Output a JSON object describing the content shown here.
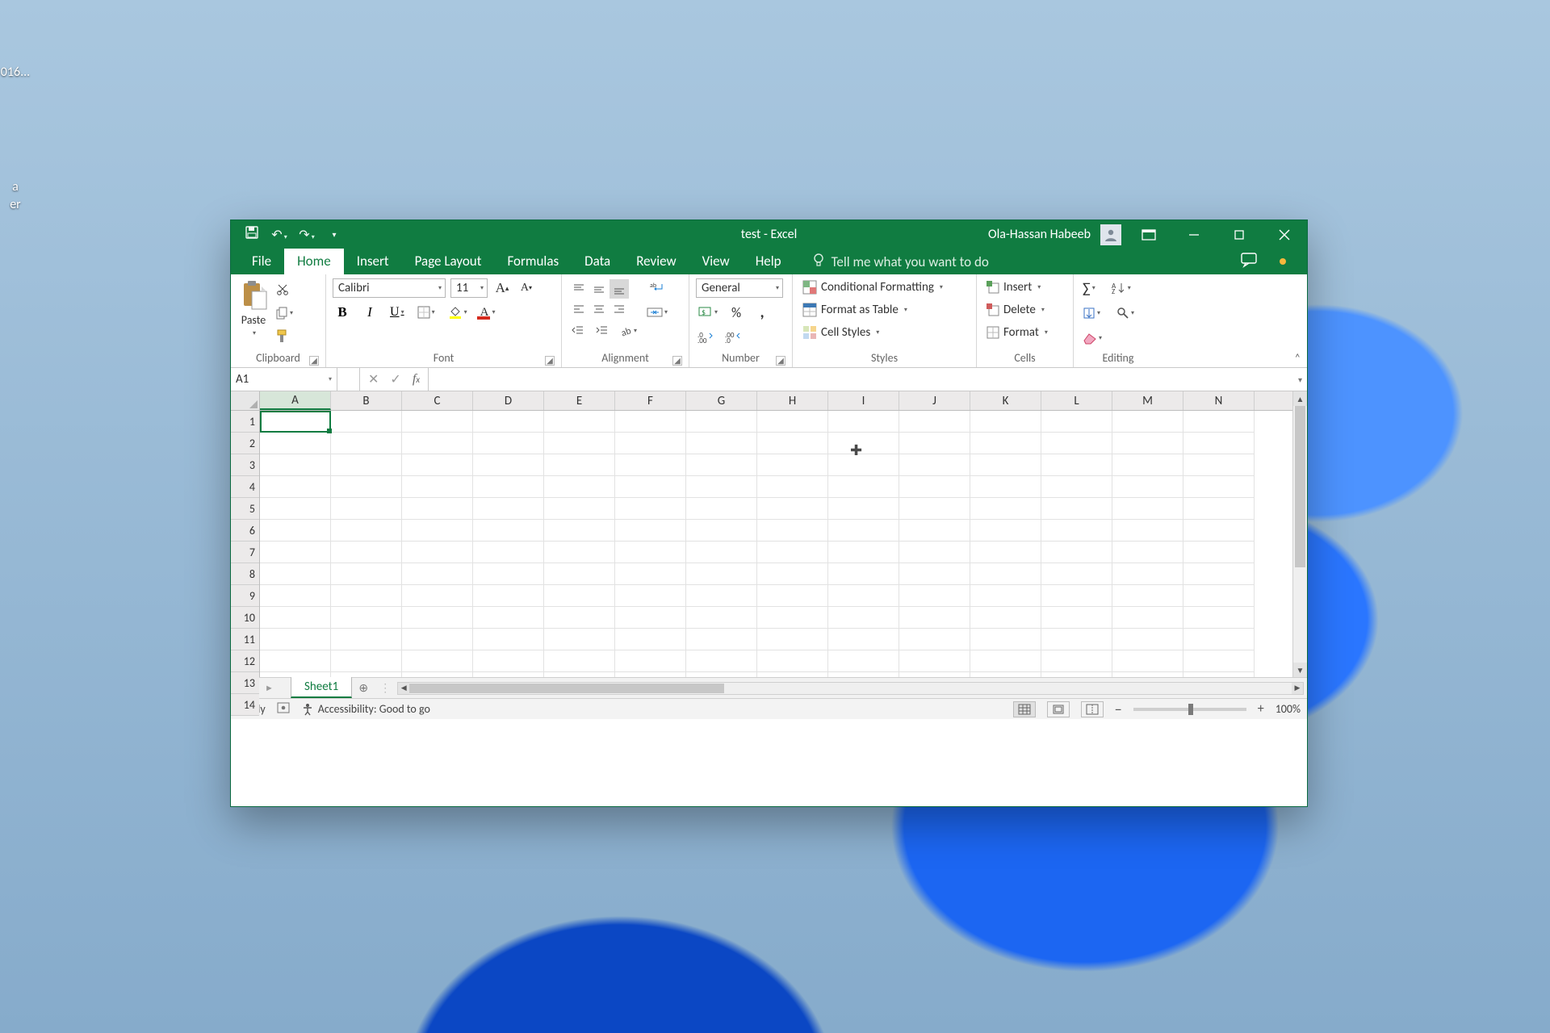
{
  "desktop": {
    "icon1_label": "016...",
    "icon2_label": "a",
    "icon3_label": "er"
  },
  "titlebar": {
    "doc_title": "test  -  Excel",
    "user_name": "Ola-Hassan Habeeb"
  },
  "tabs": {
    "file": "File",
    "home": "Home",
    "insert": "Insert",
    "page_layout": "Page Layout",
    "formulas": "Formulas",
    "data": "Data",
    "review": "Review",
    "view": "View",
    "help": "Help",
    "tell_me": "Tell me what you want to do"
  },
  "ribbon": {
    "clipboard": {
      "paste": "Paste",
      "label": "Clipboard"
    },
    "font": {
      "name": "Calibri",
      "size": "11",
      "label": "Font"
    },
    "alignment": {
      "label": "Alignment"
    },
    "number": {
      "format": "General",
      "label": "Number"
    },
    "styles": {
      "cond_fmt": "Conditional Formatting",
      "as_table": "Format as Table",
      "cell_styles": "Cell Styles",
      "label": "Styles"
    },
    "cells": {
      "insert": "Insert",
      "delete": "Delete",
      "format": "Format",
      "label": "Cells"
    },
    "editing": {
      "label": "Editing"
    }
  },
  "namebox": {
    "value": "A1"
  },
  "grid": {
    "cols": [
      "A",
      "B",
      "C",
      "D",
      "E",
      "F",
      "G",
      "H",
      "I",
      "J",
      "K",
      "L",
      "M",
      "N"
    ],
    "rows": [
      "1",
      "2",
      "3",
      "4",
      "5",
      "6",
      "7",
      "8",
      "9",
      "10",
      "11",
      "12",
      "13",
      "14"
    ]
  },
  "sheets": {
    "sheet1": "Sheet1"
  },
  "statusbar": {
    "ready": "Ready",
    "accessibility": "Accessibility: Good to go",
    "zoom": "100%"
  }
}
